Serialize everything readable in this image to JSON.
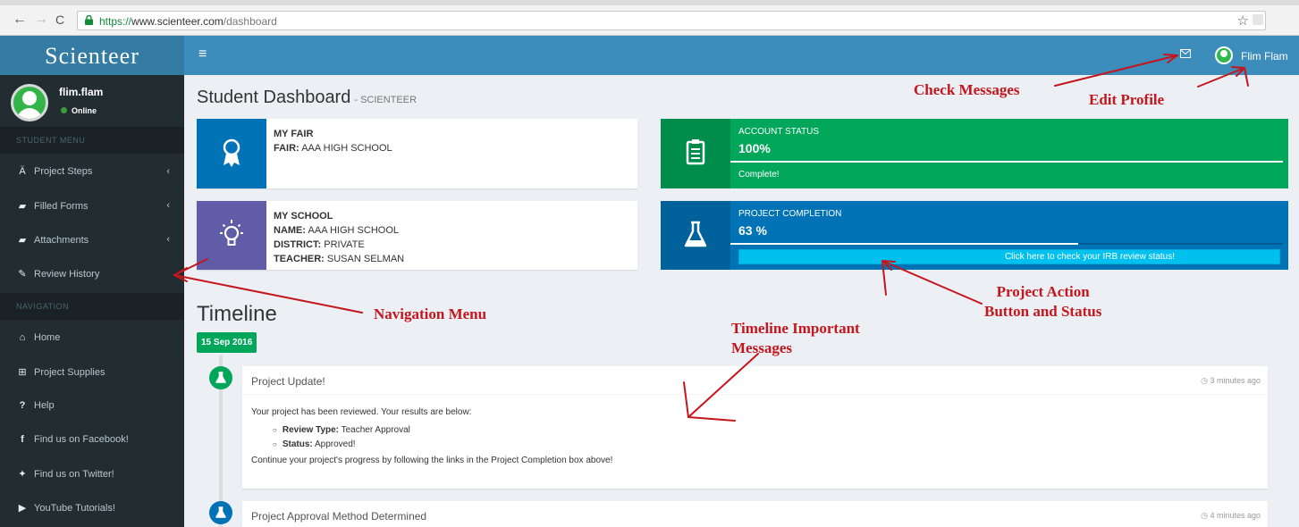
{
  "browser": {
    "url_prefix": "https://",
    "url_host": "www.scienteer.com",
    "url_path": "/dashboard",
    "back_icon": "←",
    "forward_icon": "→",
    "reload_icon": "C",
    "star_icon": "☆"
  },
  "header": {
    "logo": "Scienteer",
    "menu_icon": "≡",
    "user_name": "Flim Flam"
  },
  "sidebar": {
    "user_name": "flim.flam",
    "user_status": "Online",
    "student_menu_header": "STUDENT MENU",
    "student_items": [
      {
        "label": "Project Steps",
        "icon": "flask"
      },
      {
        "label": "Filled Forms",
        "icon": "folder"
      },
      {
        "label": "Attachments",
        "icon": "folder"
      },
      {
        "label": "Review History",
        "icon": "pencil"
      }
    ],
    "navigation_header": "NAVIGATION",
    "nav_items": [
      {
        "label": "Home",
        "icon": "home"
      },
      {
        "label": "Project Supplies",
        "icon": "cart"
      },
      {
        "label": "Help",
        "icon": "question"
      },
      {
        "label": "Find us on Facebook!",
        "icon": "facebook"
      },
      {
        "label": "Find us on Twitter!",
        "icon": "twitter"
      },
      {
        "label": "YouTube Tutorials!",
        "icon": "youtube"
      }
    ]
  },
  "page": {
    "title": "Student Dashboard",
    "subtitle": "- SCIENTEER"
  },
  "fair_box": {
    "title": "MY FAIR",
    "fair_label": "FAIR:",
    "fair_value": "AAA HIGH SCHOOL",
    "color": "#0073b7"
  },
  "school_box": {
    "title": "MY SCHOOL",
    "name_label": "NAME:",
    "name_value": "AAA HIGH SCHOOL",
    "district_label": "DISTRICT:",
    "district_value": "PRIVATE",
    "teacher_label": "TEACHER:",
    "teacher_value": "SUSAN SELMAN",
    "color": "#605ca8"
  },
  "account_status": {
    "label": "ACCOUNT STATUS",
    "value": "100%",
    "progress": 1.0,
    "description": "Complete!",
    "color": "#00a65a"
  },
  "project_completion": {
    "label": "PROJECT COMPLETION",
    "value": "63 %",
    "progress": 0.63,
    "button_label": "Click here to check your IRB review status!",
    "color": "#0073b7"
  },
  "timeline": {
    "title": "Timeline",
    "date_label": "15 Sep 2016",
    "items": [
      {
        "title": "Project Update!",
        "time": "3 minutes ago",
        "intro": "Your project has been reviewed. Your results are below:",
        "review_type_label": "Review Type:",
        "review_type_value": "Teacher Approval",
        "status_label": "Status:",
        "status_value": "Approved!",
        "outro": "Continue your project's progress by following the links in the Project Completion box above!"
      },
      {
        "title": "Project Approval Method Determined",
        "time": "4 minutes ago"
      }
    ]
  },
  "annotations": {
    "check_messages": "Check Messages",
    "edit_profile": "Edit Profile",
    "navigation_menu": "Navigation Menu",
    "timeline_messages_1": "Timeline Important",
    "timeline_messages_2": "Messages",
    "project_action_1": "Project Action",
    "project_action_2": "Button and Status",
    "color": "#c4161c"
  }
}
